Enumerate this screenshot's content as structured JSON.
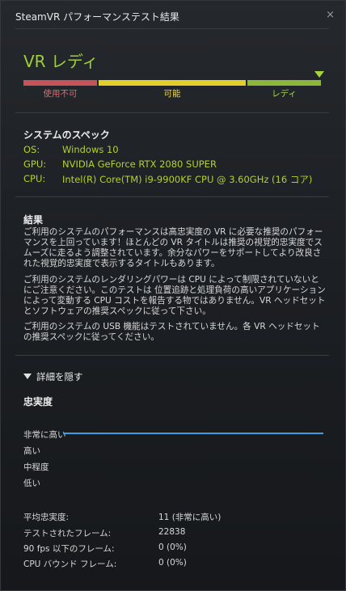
{
  "window": {
    "title": "SteamVR パフォーマンステスト結果",
    "close": "×"
  },
  "status": {
    "label": "VR レディ",
    "accent": "#9fcf3a"
  },
  "bar": {
    "segments": [
      {
        "label": "使用不可",
        "color": "#c4545a",
        "text_color": "#e06a70"
      },
      {
        "label": "可能",
        "color": "#e3cf2c",
        "text_color": "#ecd742"
      },
      {
        "label": "レディ",
        "color": "#8bb83a",
        "text_color": "#a9d648"
      }
    ]
  },
  "specs": {
    "title": "システムのスペック",
    "os": {
      "key": "OS:",
      "value": "Windows 10"
    },
    "gpu": {
      "key": "GPU:",
      "value": "NVIDIA GeForce RTX 2080 SUPER"
    },
    "cpu": {
      "key": "CPU:",
      "value": "Intel(R) Core(TM) i9-9900KF CPU @ 3.60GHz (16 コア)"
    }
  },
  "results": {
    "title": "結果",
    "p1": "ご利用のシステムのパフォーマンスは高忠実度の VR に必要な推奨のパフォーマンスを上回っています！ほとんどの VR タイトルは推奨の視覚的忠実度でスムーズに走るよう調整されています。余分なパワーをサポートしてより改良された視覚的忠実度で表示するタイトルもあります。",
    "p2": "ご利用のシステムのレンダリングパワーは CPU によって制限されていないとにご注意ください。このテストは 位置追跡と処理負荷の高いアプリケーションによって変動する CPU コストを報告する物ではありません。VR ヘッドセットとソフトウェアの推奨スペックに従って下さい。",
    "p3": "ご利用のシステムの USB 機能はテストされていません。各 VR ヘッドセットの推奨スペックに従ってください。"
  },
  "details": {
    "toggle": "詳細を隠す",
    "fidelity_title": "忠実度",
    "levels": [
      "非常に高い",
      "高い",
      "中程度",
      "低い"
    ],
    "line_color": "#3d9de0",
    "stats": [
      {
        "key": "平均忠実度:",
        "value": "11 (非常に高い)"
      },
      {
        "key": "テストされたフレーム:",
        "value": "22838"
      },
      {
        "key": "90 fps 以下のフレーム:",
        "value": "0 (0%)"
      },
      {
        "key": "CPU バウンド フレーム:",
        "value": "0 (0%)"
      }
    ]
  }
}
